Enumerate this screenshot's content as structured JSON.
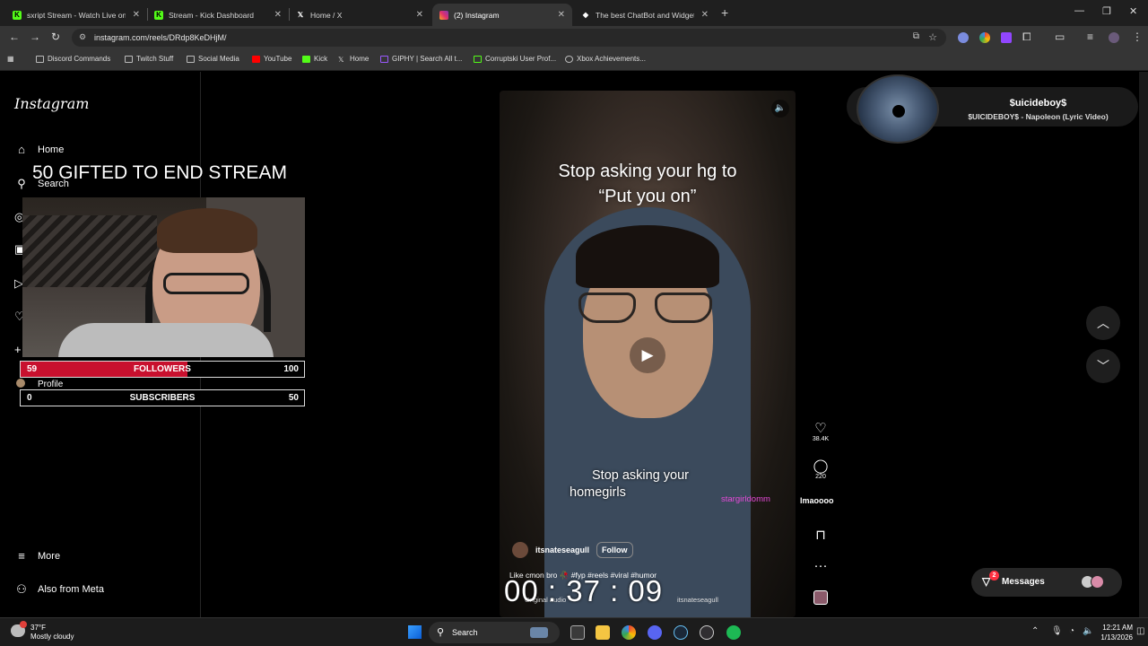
{
  "browser": {
    "tabs": [
      {
        "label": "sxript Stream - Watch Live on K",
        "icon": "kick-icon",
        "active": false
      },
      {
        "label": "Stream - Kick Dashboard",
        "icon": "kick-icon",
        "active": false
      },
      {
        "label": "Home / X",
        "icon": "x-icon",
        "active": false
      },
      {
        "label": "(2) Instagram",
        "icon": "instagram-icon",
        "active": true
      },
      {
        "label": "The best ChatBot and Widgets",
        "icon": "botrix-icon",
        "active": false
      }
    ],
    "url": "instagram.com/reels/DRdp8KeDHjM/",
    "bookmarks": [
      {
        "label": "Discord Commands",
        "icon": "folder-icon"
      },
      {
        "label": "Twitch Stuff",
        "icon": "folder-icon"
      },
      {
        "label": "Social Media",
        "icon": "folder-icon"
      },
      {
        "label": "YouTube",
        "icon": "youtube-icon"
      },
      {
        "label": "Kick",
        "icon": "kick-icon"
      },
      {
        "label": "Home",
        "icon": "x-icon"
      },
      {
        "label": "GIPHY | Search All t...",
        "icon": "giphy-icon"
      },
      {
        "label": "Corruptski User Prof...",
        "icon": "link-icon"
      },
      {
        "label": "Xbox Achievements...",
        "icon": "xbox-icon"
      }
    ]
  },
  "instagram": {
    "logo": "Instagram",
    "nav": {
      "home": "Home",
      "search": "Search",
      "profile": "Profile",
      "more": "More",
      "meta": "Also from Meta"
    },
    "reel": {
      "headline_line1": "Stop asking your hg to",
      "headline_line2": "“Put you on”",
      "caption_line1": "Stop asking your",
      "caption_line2": "homegirls",
      "username": "itsnateseagull",
      "follow": "Follow",
      "description": "Like cmon bro 🥀 #fyp #reels #viral #humor",
      "audio": "Original audio",
      "audio_user": "itsnateseagull",
      "likes": "38.4K",
      "comments": "220"
    },
    "messages": {
      "label": "Messages",
      "badge": "2"
    }
  },
  "overlay": {
    "goal_text": "50 GIFTED TO END STREAM",
    "followers": {
      "current": "59",
      "label": "FOLLOWERS",
      "max": "100",
      "progress": 0.59
    },
    "subscribers": {
      "current": "0",
      "label": "SUBSCRIBERS",
      "max": "50",
      "progress": 0
    },
    "timer": "00 : 37 : 09",
    "chat_user": "stargirldomm",
    "chat_message": "lmaoooo"
  },
  "now_playing": {
    "artist": "$uicideboy$",
    "track": "$UICIDEBOY$ - Napoleon (Lyric Video)"
  },
  "taskbar": {
    "temperature": "37°F",
    "weather": "Mostly cloudy",
    "search": "Search",
    "time": "12:21 AM",
    "date": "1/13/2026"
  },
  "colors": {
    "goal_fill": "#c8102e",
    "chat_user": "#e64ad9",
    "notification_badge": "#ff3040"
  }
}
